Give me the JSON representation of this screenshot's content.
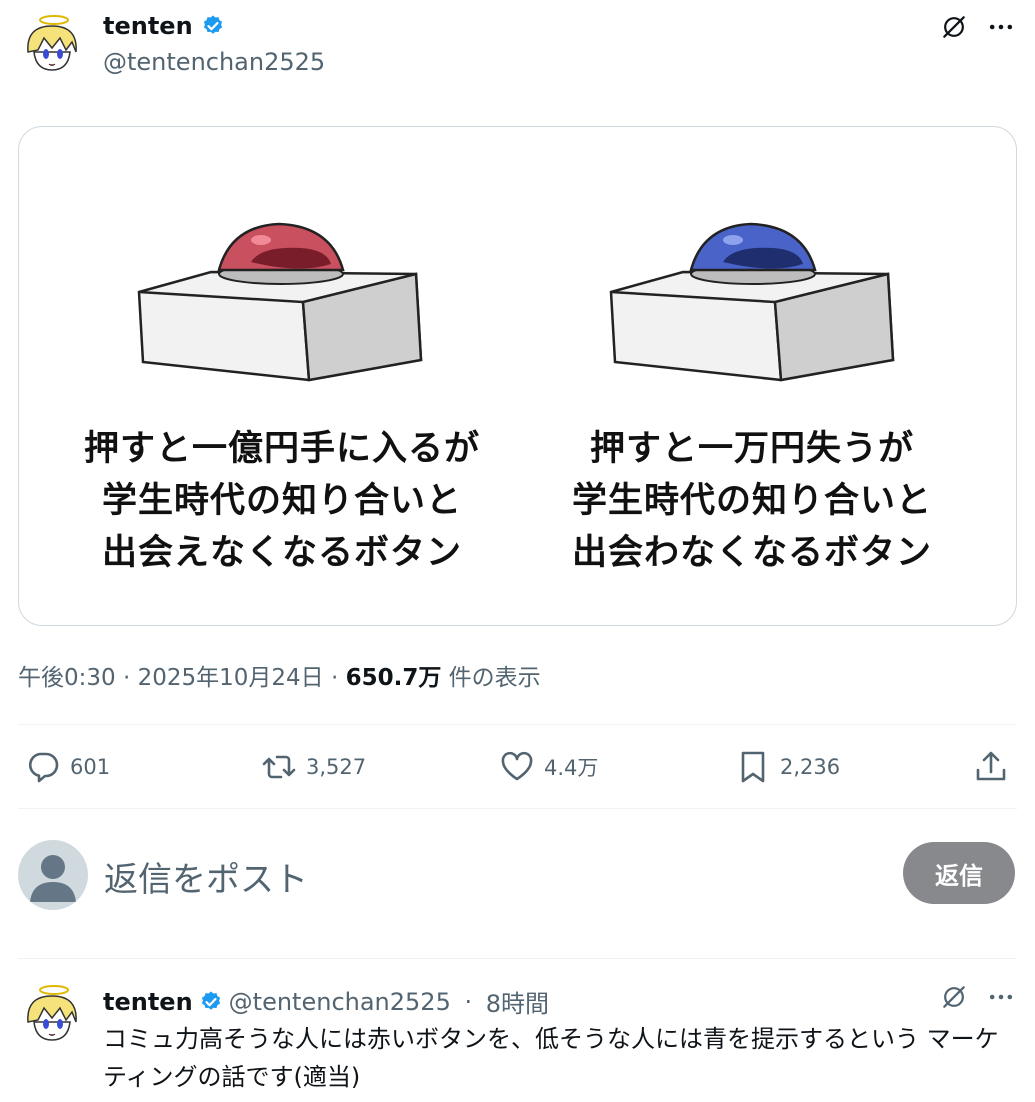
{
  "post": {
    "author_name": "tenten",
    "author_handle": "@tentenchan2525",
    "verified": true,
    "icons": [
      "grok-icon",
      "more-icon"
    ],
    "media": {
      "left_caption": "押すと一億円手に入るが\n学生時代の知り合いと\n出会えなくなるボタン",
      "right_caption": "押すと一万円失うが\n学生時代の知り合いと\n出会わなくなるボタン",
      "left_button_color": "#c9505e",
      "right_button_color": "#4a63c9"
    },
    "timestamp": "午後0:30 · 2025年10月24日 · ",
    "views_value": "650.7万",
    "views_suffix": " 件の表示"
  },
  "actions": {
    "replies": "601",
    "reposts": "3,527",
    "likes": "4.4万",
    "bookmarks": "2,236"
  },
  "composer": {
    "placeholder": "返信をポスト",
    "button_label": "返信"
  },
  "reply": {
    "author_name": "tenten",
    "author_handle": "@tentenchan2525",
    "separator": " · ",
    "time": "8時間",
    "text": "コミュ力高そうな人には赤いボタンを、低そうな人には青を提示するという マーケティングの話です(適当)"
  },
  "colors": {
    "verified": "#1d9bf0",
    "muted": "#536471",
    "reply_button": "#87898c"
  }
}
